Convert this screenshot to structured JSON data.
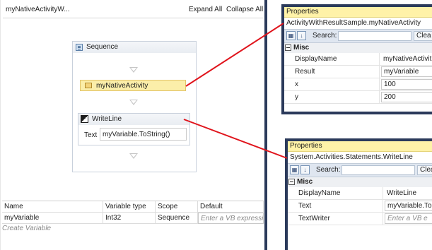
{
  "designer": {
    "title": "myNativeActivityW...",
    "expand_all": "Expand All",
    "collapse_all": "Collapse All",
    "sequence": {
      "title": "Sequence"
    },
    "native_activity": {
      "label": "myNativeActivity"
    },
    "writeline": {
      "title": "WriteLine",
      "text_label": "Text",
      "text_value": "myVariable.ToString()"
    },
    "variables": {
      "columns": [
        "Name",
        "Variable type",
        "Scope",
        "Default"
      ],
      "rows": [
        {
          "name": "myVariable",
          "type": "Int32",
          "scope": "Sequence",
          "default_placeholder": "Enter a VB expressic"
        }
      ],
      "create_label": "Create Variable"
    }
  },
  "properties_1": {
    "title": "Properties",
    "object": "ActivityWithResultSample.myNativeActivity",
    "search_label": "Search:",
    "clear_label": "Clea",
    "category": "Misc",
    "rows": [
      {
        "name": "DisplayName",
        "value": "myNativeActivit",
        "boxed": false
      },
      {
        "name": "Result",
        "value": "myVariable",
        "boxed": true
      },
      {
        "name": "x",
        "value": "100",
        "boxed": true
      },
      {
        "name": "y",
        "value": "200",
        "boxed": true
      }
    ]
  },
  "properties_2": {
    "title": "Properties",
    "object": "System.Activities.Statements.WriteLine",
    "search_label": "Search:",
    "clear_label": "Clea",
    "category": "Misc",
    "rows": [
      {
        "name": "DisplayName",
        "value": "WriteLine",
        "boxed": false
      },
      {
        "name": "Text",
        "value": "myVariable.To",
        "boxed": true
      },
      {
        "name": "TextWriter",
        "value": "Enter a VB e",
        "boxed": true,
        "placeholder": true
      }
    ]
  },
  "colors": {
    "window_border": "#2b3a5b",
    "properties_title_bg": "#fff2a8",
    "selected_activity_bg": "#fbeea9",
    "connector_line": "#e0141c"
  },
  "icons": {
    "sequence": "sequence-icon",
    "native_activity": "activity-icon",
    "writeline": "writeline-icon",
    "categorized": "categorized-icon",
    "alphabetical": "sort-az-icon"
  }
}
